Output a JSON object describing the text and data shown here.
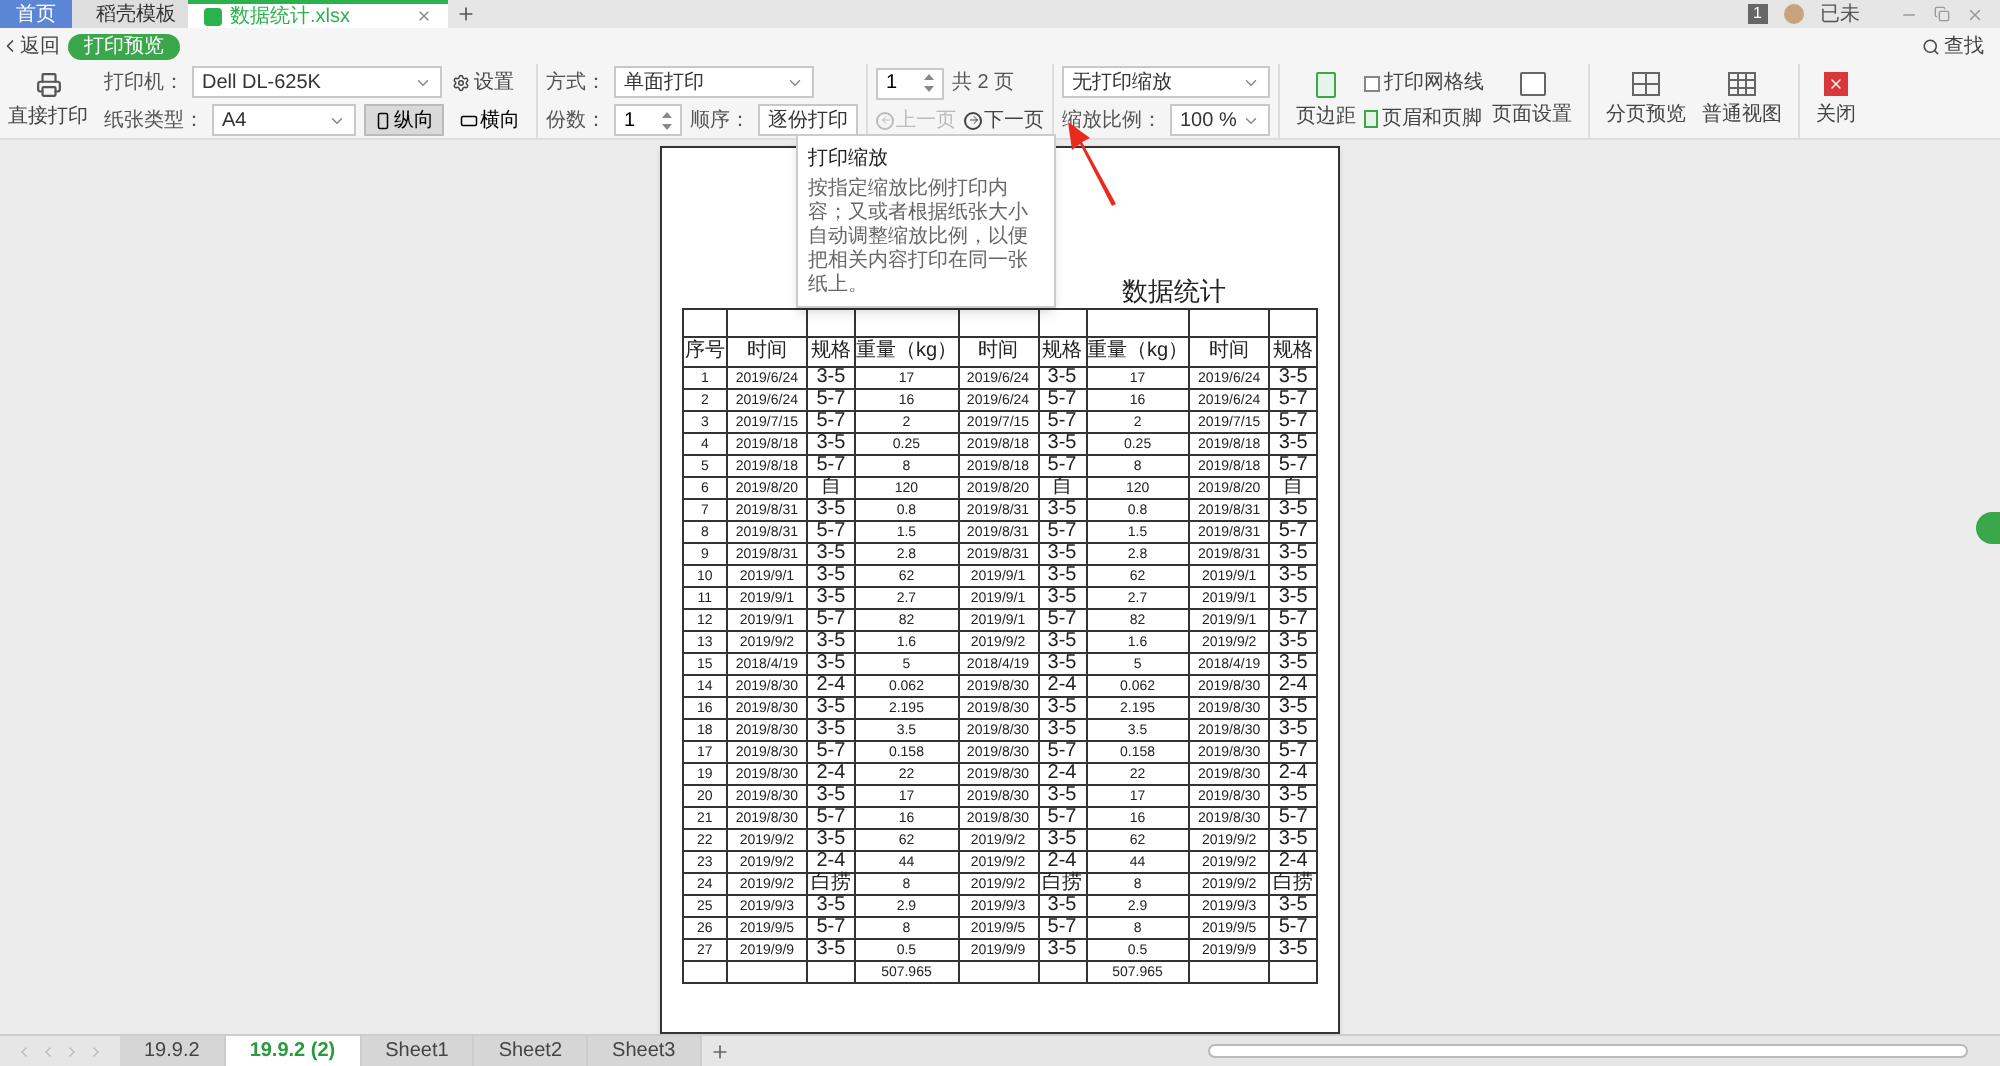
{
  "tabs": [
    {
      "label": "首页",
      "kind": "home",
      "selected": false
    },
    {
      "label": "稻壳模板",
      "kind": "template",
      "selected": false
    },
    {
      "label": "数据统计.xlsx",
      "kind": "sheet",
      "selected": true
    }
  ],
  "user": {
    "badge": "1",
    "name": "已未"
  },
  "back": "返回",
  "mode": "打印预览",
  "search": "查找",
  "toolbar": {
    "direct_print": "直接打印",
    "printer_label": "打印机：",
    "printer": "Dell DL-625K",
    "settings": "设置",
    "paper_label": "纸张类型：",
    "paper": "A4",
    "orientations": [
      {
        "label": "纵向",
        "kind": "portrait",
        "selected": true
      },
      {
        "label": "横向",
        "kind": "landscape",
        "selected": false
      }
    ],
    "method_label": "方式：",
    "method": "单面打印",
    "copies_label": "份数：",
    "copies": "1",
    "order_label": "顺序：",
    "order": "逐份打印",
    "page": "1",
    "page_total": "共 2 页",
    "prev": {
      "label": "上一页",
      "disabled": true
    },
    "next": {
      "label": "下一页",
      "disabled": false
    },
    "scaling": "无打印缩放",
    "ratio_label": "缩放比例：",
    "ratio": "100 %",
    "margins": "页边距",
    "gridlines": {
      "label": "打印网格线",
      "checked": false
    },
    "header_footer": "页眉和页脚",
    "page_setup": "页面设置",
    "page_break": "分页预览",
    "normal_view": "普通视图",
    "close": "关闭"
  },
  "tooltip": {
    "title": "打印缩放",
    "text": "按指定缩放比例打印内容；又或者根据纸张大小自动调整缩放比例，以便把相关内容打印在同一张纸上。"
  },
  "sheet": {
    "title": "数据统计",
    "headers": [
      "序号",
      "时间",
      "规格",
      "重量（kg）",
      "时间",
      "规格",
      "重量（kg）",
      "时间",
      "规格"
    ],
    "rows": [
      [
        "1",
        "2019/6/24",
        "3-5",
        "17",
        "2019/6/24",
        "3-5",
        "17",
        "2019/6/24",
        "3-5"
      ],
      [
        "2",
        "2019/6/24",
        "5-7",
        "16",
        "2019/6/24",
        "5-7",
        "16",
        "2019/6/24",
        "5-7"
      ],
      [
        "3",
        "2019/7/15",
        "5-7",
        "2",
        "2019/7/15",
        "5-7",
        "2",
        "2019/7/15",
        "5-7"
      ],
      [
        "4",
        "2019/8/18",
        "3-5",
        "0.25",
        "2019/8/18",
        "3-5",
        "0.25",
        "2019/8/18",
        "3-5"
      ],
      [
        "5",
        "2019/8/18",
        "5-7",
        "8",
        "2019/8/18",
        "5-7",
        "8",
        "2019/8/18",
        "5-7"
      ],
      [
        "6",
        "2019/8/20",
        "自",
        "120",
        "2019/8/20",
        "自",
        "120",
        "2019/8/20",
        "自"
      ],
      [
        "7",
        "2019/8/31",
        "3-5",
        "0.8",
        "2019/8/31",
        "3-5",
        "0.8",
        "2019/8/31",
        "3-5"
      ],
      [
        "8",
        "2019/8/31",
        "5-7",
        "1.5",
        "2019/8/31",
        "5-7",
        "1.5",
        "2019/8/31",
        "5-7"
      ],
      [
        "9",
        "2019/8/31",
        "3-5",
        "2.8",
        "2019/8/31",
        "3-5",
        "2.8",
        "2019/8/31",
        "3-5"
      ],
      [
        "10",
        "2019/9/1",
        "3-5",
        "62",
        "2019/9/1",
        "3-5",
        "62",
        "2019/9/1",
        "3-5"
      ],
      [
        "11",
        "2019/9/1",
        "3-5",
        "2.7",
        "2019/9/1",
        "3-5",
        "2.7",
        "2019/9/1",
        "3-5"
      ],
      [
        "12",
        "2019/9/1",
        "5-7",
        "82",
        "2019/9/1",
        "5-7",
        "82",
        "2019/9/1",
        "5-7"
      ],
      [
        "13",
        "2019/9/2",
        "3-5",
        "1.6",
        "2019/9/2",
        "3-5",
        "1.6",
        "2019/9/2",
        "3-5"
      ],
      [
        "15",
        "2018/4/19",
        "3-5",
        "5",
        "2018/4/19",
        "3-5",
        "5",
        "2018/4/19",
        "3-5"
      ],
      [
        "14",
        "2019/8/30",
        "2-4",
        "0.062",
        "2019/8/30",
        "2-4",
        "0.062",
        "2019/8/30",
        "2-4"
      ],
      [
        "16",
        "2019/8/30",
        "3-5",
        "2.195",
        "2019/8/30",
        "3-5",
        "2.195",
        "2019/8/30",
        "3-5"
      ],
      [
        "18",
        "2019/8/30",
        "3-5",
        "3.5",
        "2019/8/30",
        "3-5",
        "3.5",
        "2019/8/30",
        "3-5"
      ],
      [
        "17",
        "2019/8/30",
        "5-7",
        "0.158",
        "2019/8/30",
        "5-7",
        "0.158",
        "2019/8/30",
        "5-7"
      ],
      [
        "19",
        "2019/8/30",
        "2-4",
        "22",
        "2019/8/30",
        "2-4",
        "22",
        "2019/8/30",
        "2-4"
      ],
      [
        "20",
        "2019/8/30",
        "3-5",
        "17",
        "2019/8/30",
        "3-5",
        "17",
        "2019/8/30",
        "3-5"
      ],
      [
        "21",
        "2019/8/30",
        "5-7",
        "16",
        "2019/8/30",
        "5-7",
        "16",
        "2019/8/30",
        "5-7"
      ],
      [
        "22",
        "2019/9/2",
        "3-5",
        "62",
        "2019/9/2",
        "3-5",
        "62",
        "2019/9/2",
        "3-5"
      ],
      [
        "23",
        "2019/9/2",
        "2-4",
        "44",
        "2019/9/2",
        "2-4",
        "44",
        "2019/9/2",
        "2-4"
      ],
      [
        "24",
        "2019/9/2",
        "白捞",
        "8",
        "2019/9/2",
        "白捞",
        "8",
        "2019/9/2",
        "白捞"
      ],
      [
        "25",
        "2019/9/3",
        "3-5",
        "2.9",
        "2019/9/3",
        "3-5",
        "2.9",
        "2019/9/3",
        "3-5"
      ],
      [
        "26",
        "2019/9/5",
        "5-7",
        "8",
        "2019/9/5",
        "5-7",
        "8",
        "2019/9/5",
        "5-7"
      ],
      [
        "27",
        "2019/9/9",
        "3-5",
        "0.5",
        "2019/9/9",
        "3-5",
        "0.5",
        "2019/9/9",
        "3-5"
      ]
    ],
    "total": {
      "weight_1": "507.965",
      "weight_2": "507.965"
    }
  },
  "sheet_tabs": [
    {
      "label": "19.9.2",
      "selected": false
    },
    {
      "label": "19.9.2 (2)",
      "selected": true
    },
    {
      "label": "Sheet1",
      "selected": false
    },
    {
      "label": "Sheet2",
      "selected": false
    },
    {
      "label": "Sheet3",
      "selected": false
    }
  ]
}
